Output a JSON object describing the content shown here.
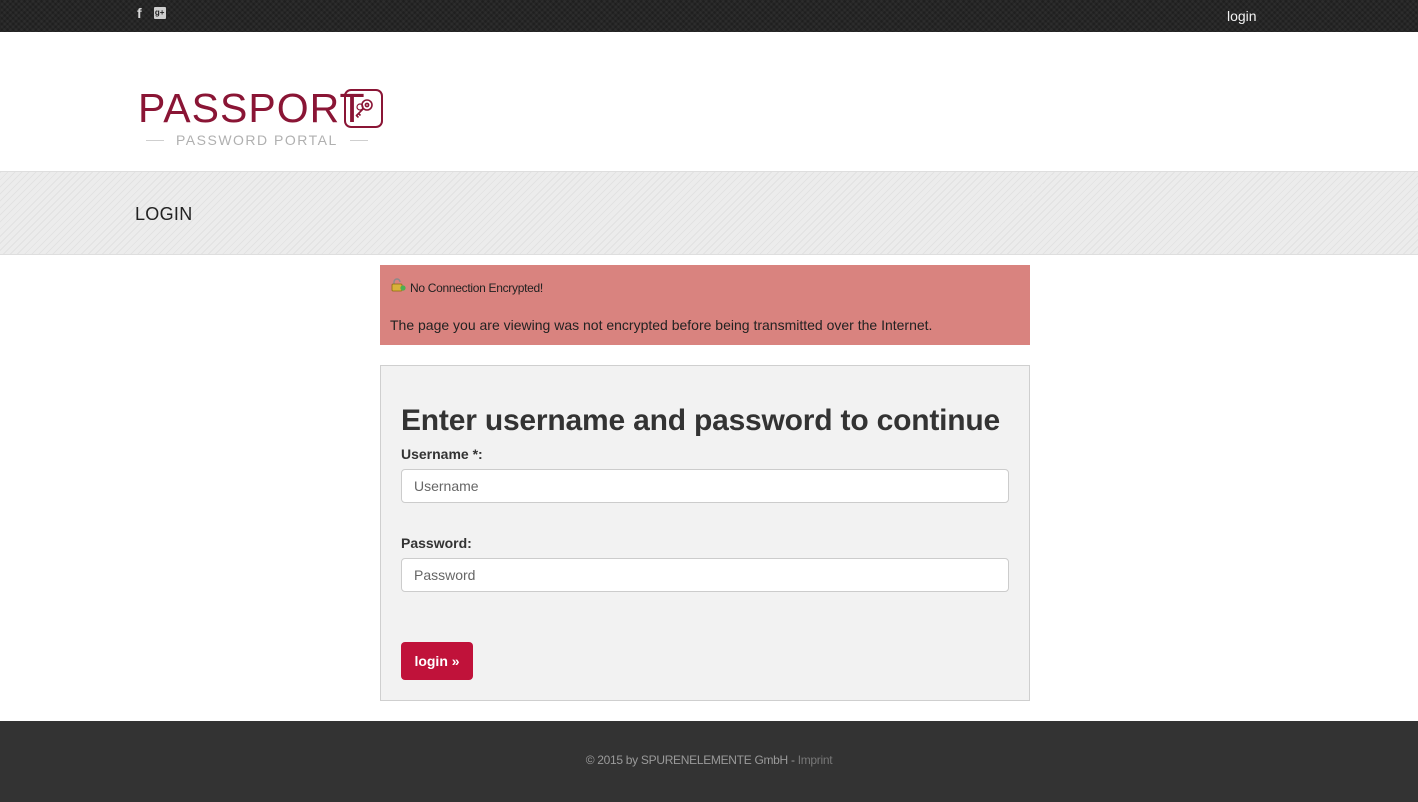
{
  "topbar": {
    "social": [
      {
        "icon": "facebook-icon",
        "glyph": "f"
      },
      {
        "icon": "google-plus-icon",
        "glyph": "g+"
      }
    ],
    "login_link": "login"
  },
  "logo": {
    "title_bold": "PASS",
    "title_light": "PORT",
    "subtitle": "PASSWORD PORTAL",
    "icon": "key-icon",
    "brand_color": "#8a1535"
  },
  "page": {
    "title": "LOGIN"
  },
  "alert": {
    "icon": "unlocked-warning-icon",
    "heading": "No Connection Encrypted!",
    "message": "The page you are viewing was not encrypted before being transmitted over the Internet.",
    "background_color": "#d9837f"
  },
  "login_form": {
    "heading": "Enter username and password to continue",
    "username": {
      "label": "Username *:",
      "placeholder": "Username",
      "value": ""
    },
    "password": {
      "label": "Password:",
      "placeholder": "Password",
      "value": ""
    },
    "submit_label": "login »",
    "button_color": "#c0123a"
  },
  "footer": {
    "copyright": "© 2015 by  SPURENELEMENTE GmbH -",
    "imprint_link": "Imprint"
  }
}
